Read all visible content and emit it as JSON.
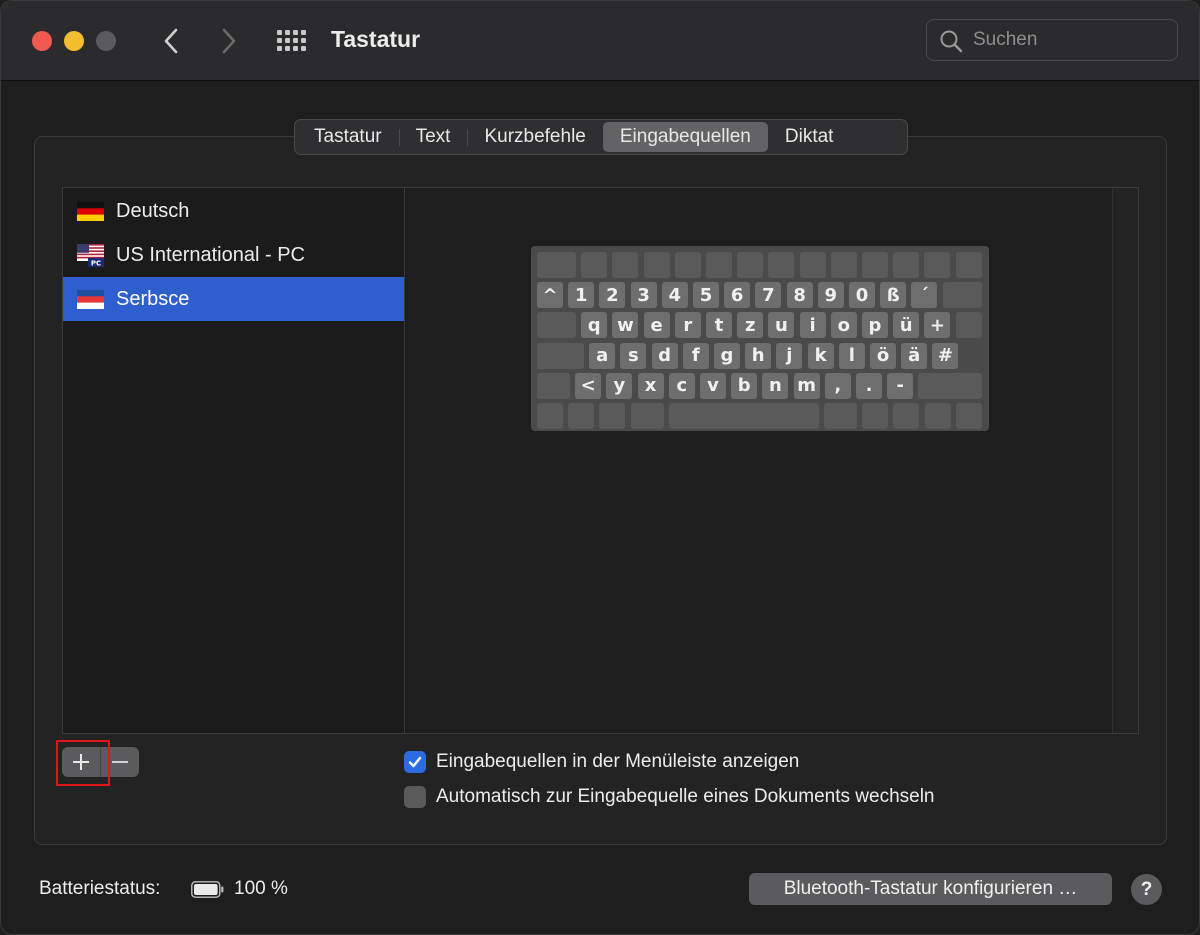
{
  "window": {
    "title": "Tastatur",
    "search_placeholder": "Suchen"
  },
  "tabs": [
    {
      "label": "Tastatur",
      "active": false
    },
    {
      "label": "Text",
      "active": false
    },
    {
      "label": "Kurzbefehle",
      "active": false
    },
    {
      "label": "Eingabequellen",
      "active": true
    },
    {
      "label": "Diktat",
      "active": false
    }
  ],
  "input_sources": [
    {
      "label": "Deutsch",
      "flag": "flag-germany-icon",
      "selected": false
    },
    {
      "label": "US International - PC",
      "flag": "flag-us-pc-icon",
      "selected": false
    },
    {
      "label": "Serbsce",
      "flag": "flag-sorbian-icon",
      "selected": true
    }
  ],
  "keyboard_rows": [
    [
      "",
      "",
      "",
      "",
      "",
      "",
      "",
      "",
      "",
      "",
      "",
      "",
      "",
      ""
    ],
    [
      "^",
      "1",
      "2",
      "3",
      "4",
      "5",
      "6",
      "7",
      "8",
      "9",
      "0",
      "ß",
      "´",
      ""
    ],
    [
      "",
      "q",
      "w",
      "e",
      "r",
      "t",
      "z",
      "u",
      "i",
      "o",
      "p",
      "ü",
      "+",
      ""
    ],
    [
      "",
      "a",
      "s",
      "d",
      "f",
      "g",
      "h",
      "j",
      "k",
      "l",
      "ö",
      "ä",
      "#"
    ],
    [
      "",
      "<",
      "y",
      "x",
      "c",
      "v",
      "b",
      "n",
      "m",
      ",",
      ".",
      "-",
      ""
    ],
    [
      "",
      "",
      "",
      "",
      "",
      "",
      "",
      "",
      "",
      ""
    ]
  ],
  "list_buttons": {
    "add": "+",
    "remove": "−"
  },
  "options": [
    {
      "label": "Eingabequellen in der Menüleiste anzeigen",
      "checked": true
    },
    {
      "label": "Automatisch zur Eingabequelle eines Dokuments wechseln",
      "checked": false
    }
  ],
  "footer": {
    "battery_label": "Batteriestatus:",
    "battery_value": "100 %",
    "bluetooth_button": "Bluetooth-Tastatur konfigurieren …",
    "help": "?"
  },
  "colors": {
    "selection": "#2f5fcf",
    "checkbox_on": "#2d6be2",
    "highlight": "#e0161c"
  }
}
